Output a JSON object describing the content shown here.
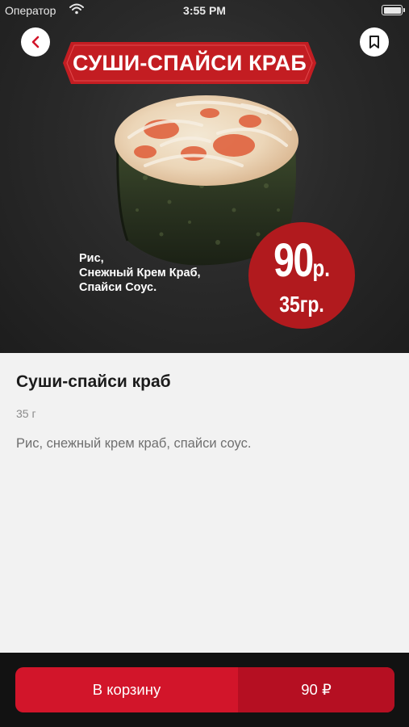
{
  "status_bar": {
    "carrier": "Оператор",
    "time": "3:55 PM"
  },
  "hero": {
    "banner_title": "СУШИ-СПАЙСИ КРАБ",
    "ingredients": [
      "Рис,",
      "Снежный Крем Краб,",
      "Спайси Соус."
    ],
    "badge_price": "90",
    "badge_currency": "р.",
    "badge_weight": "35гр."
  },
  "product": {
    "title": "Суши-спайси краб",
    "weight": "35 г",
    "description": "Рис, снежный крем краб, спайси соус."
  },
  "cart": {
    "label": "В корзину",
    "price": "90 ₽"
  },
  "colors": {
    "brand_red": "#d2152a",
    "badge_red": "#b11a1e",
    "dark_bg": "#121212"
  },
  "icons": {
    "back": "chevron-left-icon",
    "bookmark": "bookmark-icon",
    "wifi": "wifi-icon",
    "battery": "battery-icon"
  }
}
